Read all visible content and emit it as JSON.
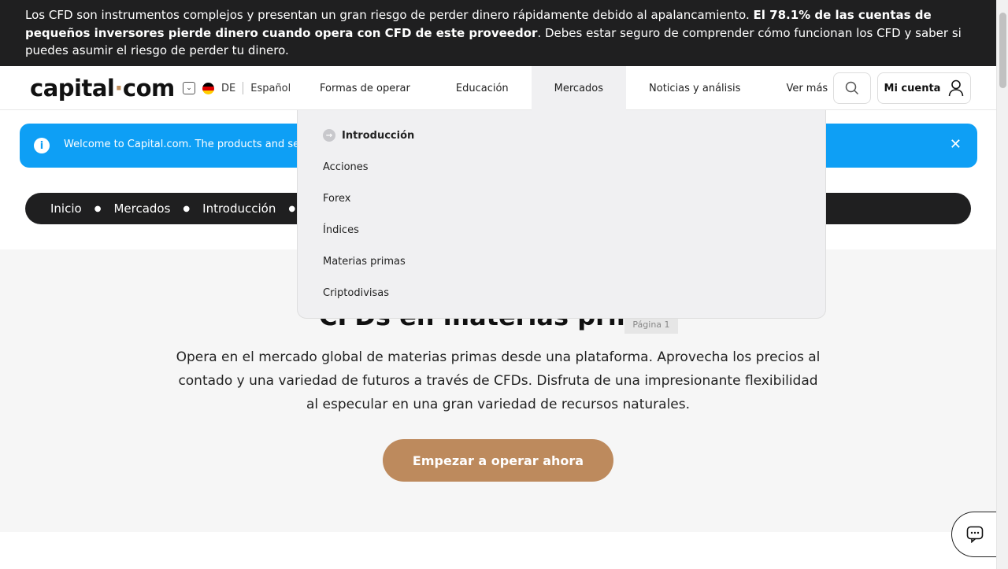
{
  "risk_banner": {
    "text_before": "Los CFD son instrumentos complejos y presentan un gran riesgo de perder dinero rápidamente debido al apalancamiento. ",
    "text_bold": "El 78.1% de las cuentas de pequeños inversores pierde dinero cuando opera con CFD de este proveedor",
    "text_after": ". Debes estar seguro de comprender cómo funcionan los CFD y saber si puedes asumir el riesgo de perder tu dinero."
  },
  "header": {
    "logo_left": "capital",
    "logo_dot": "·",
    "logo_right": "com",
    "country_code": "DE",
    "language": "Español",
    "nav": [
      "Formas de operar",
      "Educación",
      "Mercados",
      "Noticias y análisis",
      "Ver más"
    ],
    "active_nav": "Mercados",
    "account_label": "Mi cuenta",
    "icons": {
      "search": "search-icon",
      "account": "user-icon",
      "language": "chevron-down-icon",
      "flag": "germany-flag-icon"
    }
  },
  "welcome": {
    "text": "Welcome to Capital.com. The products and services",
    "icons": {
      "info": "info-icon",
      "close": "close-icon"
    }
  },
  "breadcrumb": [
    "Inicio",
    "Mercados",
    "Introducción"
  ],
  "dropdown": {
    "items": [
      "Introducción",
      "Acciones",
      "Forex",
      "Índices",
      "Materias primas",
      "Criptodivisas"
    ]
  },
  "hero": {
    "title": "CFDs en materias primas",
    "page_badge": "Página 1",
    "description": "Opera en el mercado global de materias primas desde una plataforma. Aprovecha los precios al contado y una variedad de futuros a través de CFDs. Disfruta de una impresionante flexibilidad al especular en una gran variedad de recursos naturales.",
    "cta": "Empezar a operar ahora"
  },
  "colors": {
    "accent": "#bd8a5d",
    "info_blue": "#0e9ff5",
    "dark": "#1f1f20"
  }
}
